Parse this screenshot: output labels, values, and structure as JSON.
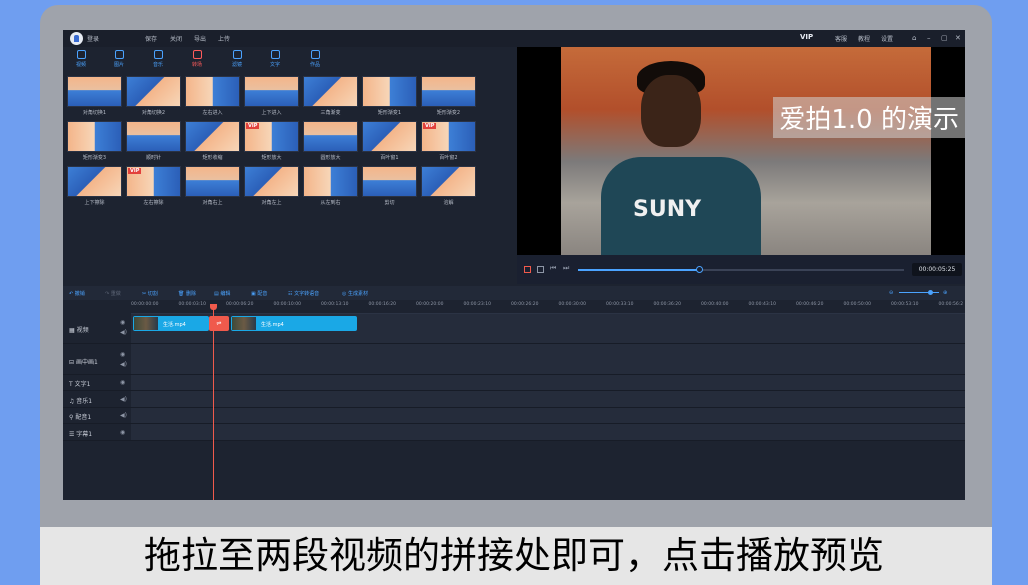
{
  "app": {
    "title_login": "登录",
    "menu": [
      "保存",
      "关闭",
      "导出",
      "上传"
    ],
    "vip": "VIP",
    "right_menu": [
      "客服",
      "教程",
      "设置"
    ]
  },
  "tools": [
    "视频",
    "图片",
    "音乐",
    "转场",
    "滤镜",
    "文字",
    "作品"
  ],
  "transitions": [
    {
      "label": "对角切换1",
      "vip": false
    },
    {
      "label": "对角切换2",
      "vip": false
    },
    {
      "label": "左右进入",
      "vip": false
    },
    {
      "label": "上下进入",
      "vip": false
    },
    {
      "label": "三角渐变",
      "vip": false
    },
    {
      "label": "矩形渐变1",
      "vip": false
    },
    {
      "label": "矩形渐变2",
      "vip": false
    },
    {
      "label": "矩形渐变3",
      "vip": false
    },
    {
      "label": "顺时针",
      "vip": false
    },
    {
      "label": "矩形收缩",
      "vip": false
    },
    {
      "label": "矩形放大",
      "vip": true
    },
    {
      "label": "圆形放大",
      "vip": false
    },
    {
      "label": "百叶窗1",
      "vip": false
    },
    {
      "label": "百叶窗2",
      "vip": true
    },
    {
      "label": "上下擦除",
      "vip": false
    },
    {
      "label": "左右擦除",
      "vip": true
    },
    {
      "label": "对角右上",
      "vip": false
    },
    {
      "label": "对角左上",
      "vip": false
    },
    {
      "label": "从左到右",
      "vip": false
    },
    {
      "label": "剪切",
      "vip": false
    },
    {
      "label": "溶解",
      "vip": false
    }
  ],
  "vip_tag": "VIP",
  "preview": {
    "watermark": "爱拍1.0 的演示",
    "jersey": "SUNY",
    "timecode": "00:00:05:25",
    "progress": 0.37
  },
  "timeline_toolbar": [
    "撤销",
    "重做",
    "切割",
    "删除",
    "编辑",
    "配音",
    "文字转语音",
    "生成素材"
  ],
  "ruler": [
    "00:00:00:00",
    "00:00:03:10",
    "00:00:06:20",
    "00:00:10:00",
    "00:00:13:10",
    "00:00:16:20",
    "00:00:20:00",
    "00:00:23:10",
    "00:00:26:20",
    "00:00:30:00",
    "00:00:33:10",
    "00:00:36:20",
    "00:00:40:00",
    "00:00:43:10",
    "00:00:46:20",
    "00:00:50:00",
    "00:00:53:10",
    "00:00:56:2"
  ],
  "tracks": [
    {
      "label": "视频",
      "icon": "film-icon"
    },
    {
      "label": "画中画1",
      "icon": "pip-icon"
    },
    {
      "label": "文字1",
      "icon": "text-icon"
    },
    {
      "label": "音乐1",
      "icon": "music-icon"
    },
    {
      "label": "配音1",
      "icon": "mic-icon"
    },
    {
      "label": "字幕1",
      "icon": "subtitle-icon"
    }
  ],
  "clips": [
    {
      "name": "生活.mp4"
    },
    {
      "name": "生活.mp4"
    }
  ],
  "caption": "拖拉至两段视频的拼接处即可，点击播放预览"
}
